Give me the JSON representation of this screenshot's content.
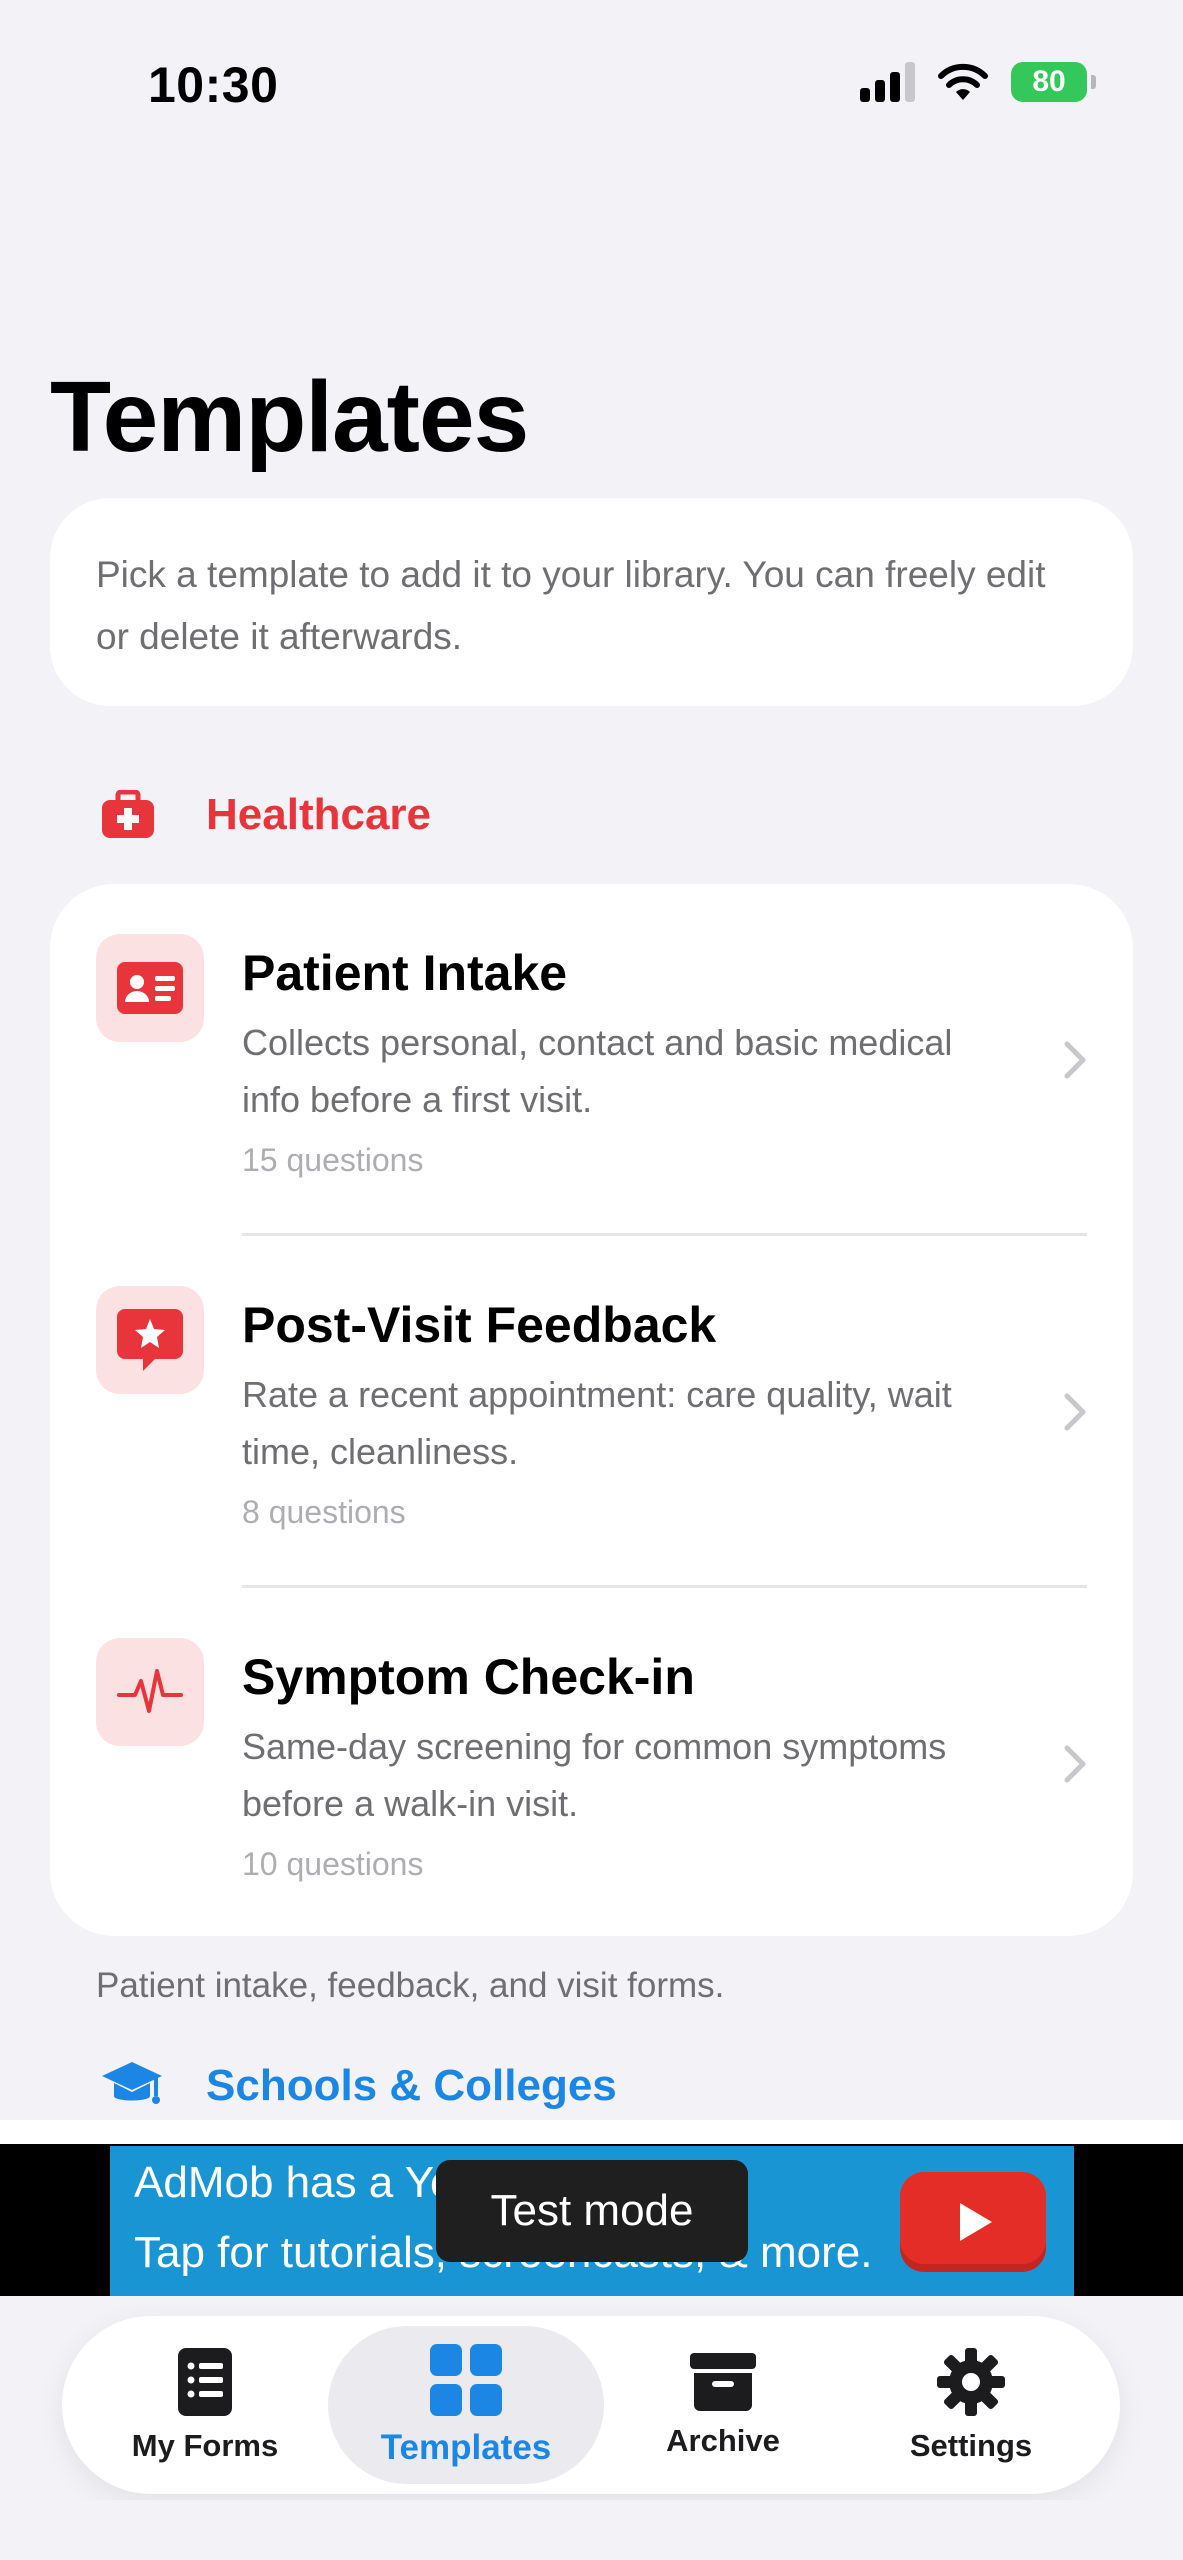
{
  "status_bar": {
    "time": "10:30",
    "battery": "80"
  },
  "page": {
    "title": "Templates",
    "intro": "Pick a template to add it to your library. You can freely edit or delete it afterwards."
  },
  "sections": [
    {
      "title": "Healthcare",
      "accent_color": "#E8343B",
      "footer": "Patient intake, feedback, and visit forms.",
      "items": [
        {
          "title": "Patient Intake",
          "description": "Collects personal, contact and basic medical info before a first visit.",
          "count": "15 questions",
          "icon": "id-card-icon"
        },
        {
          "title": "Post-Visit Feedback",
          "description": "Rate a recent appointment: care quality, wait time, cleanliness.",
          "count": "8 questions",
          "icon": "star-bubble-icon"
        },
        {
          "title": "Symptom Check-in",
          "description": "Same-day screening for common symptoms before a walk-in visit.",
          "count": "10 questions",
          "icon": "heartbeat-icon"
        }
      ]
    },
    {
      "title": "Schools & Colleges",
      "accent_color": "#1C86E5"
    }
  ],
  "ad": {
    "line1": "AdMob has a Yo",
    "line2": "Tap for tutorials, screencasts, & more.",
    "overlay": "Test mode"
  },
  "tab_bar": {
    "tabs": [
      {
        "label": "My Forms",
        "icon": "list-doc-icon"
      },
      {
        "label": "Templates",
        "icon": "grid-icon",
        "selected": true
      },
      {
        "label": "Archive",
        "icon": "archive-box-icon"
      },
      {
        "label": "Settings",
        "icon": "gear-icon"
      }
    ]
  }
}
